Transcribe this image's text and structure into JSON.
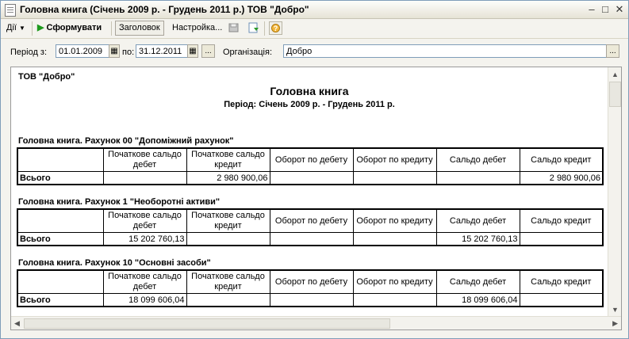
{
  "window": {
    "title": "Головна книга (Січень 2009 р. - Грудень 2011 р.) ТОВ \"Добро\"",
    "minimize": "–",
    "maximize": "□",
    "close": "✕"
  },
  "toolbar": {
    "actions_label": "Дії",
    "generate_label": "Сформувати",
    "header_label": "Заголовок",
    "settings_label": "Настройка...",
    "help_label": "?"
  },
  "params": {
    "period_from_label": "Період з:",
    "period_from_value": "01.01.2009",
    "period_to_label": "по:",
    "period_to_value": "31.12.2011",
    "select_period_button": "...",
    "organization_label": "Організація:",
    "organization_value": "Добро",
    "organization_button": "..."
  },
  "report": {
    "organization": "ТОВ \"Добро\"",
    "title": "Головна книга",
    "period": "Період: Січень 2009 р. - Грудень 2011 р.",
    "columns": [
      "",
      "Початкове сальдо дебет",
      "Початкове сальдо кредит",
      "Оборот по дебету",
      "Оборот по кредиту",
      "Сальдо дебет",
      "Сальдо кредит"
    ],
    "sections": [
      {
        "title": "Головна книга. Рахунок 00 \"Допоміжний рахунок\"",
        "row": [
          "Всього",
          "",
          "2 980 900,06",
          "",
          "",
          "",
          "2 980 900,06"
        ]
      },
      {
        "title": "Головна книга. Рахунок 1 \"Необоротні активи\"",
        "row": [
          "Всього",
          "15 202 760,13",
          "",
          "",
          "",
          "15 202 760,13",
          ""
        ]
      },
      {
        "title": "Головна книга. Рахунок 10 \"Основні засоби\"",
        "row": [
          "Всього",
          "18 099 606,04",
          "",
          "",
          "",
          "18 099 606,04",
          ""
        ]
      }
    ]
  }
}
